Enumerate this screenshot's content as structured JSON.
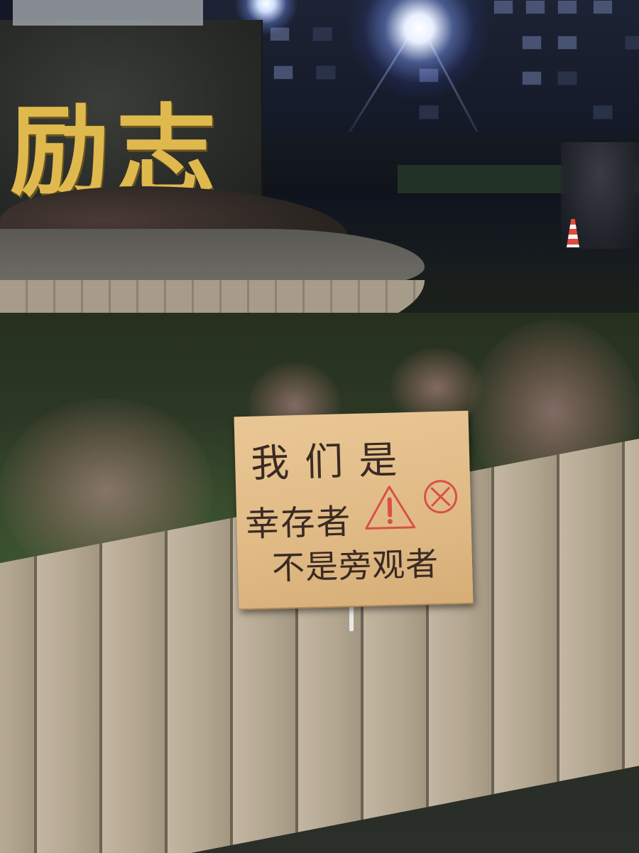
{
  "monument": {
    "inscription": "励志"
  },
  "sign": {
    "line_1": "我们是",
    "line_2": "幸存者",
    "line_3": "不是旁观者",
    "icons": [
      "warning-triangle-icon",
      "prohibited-circle-x-icon"
    ],
    "ink_color": "#3a2a24",
    "accent_color": "#d8504a",
    "cardboard_color": "#e1bb86"
  },
  "scene": {
    "calligraphy_color": "#e0b94e"
  }
}
